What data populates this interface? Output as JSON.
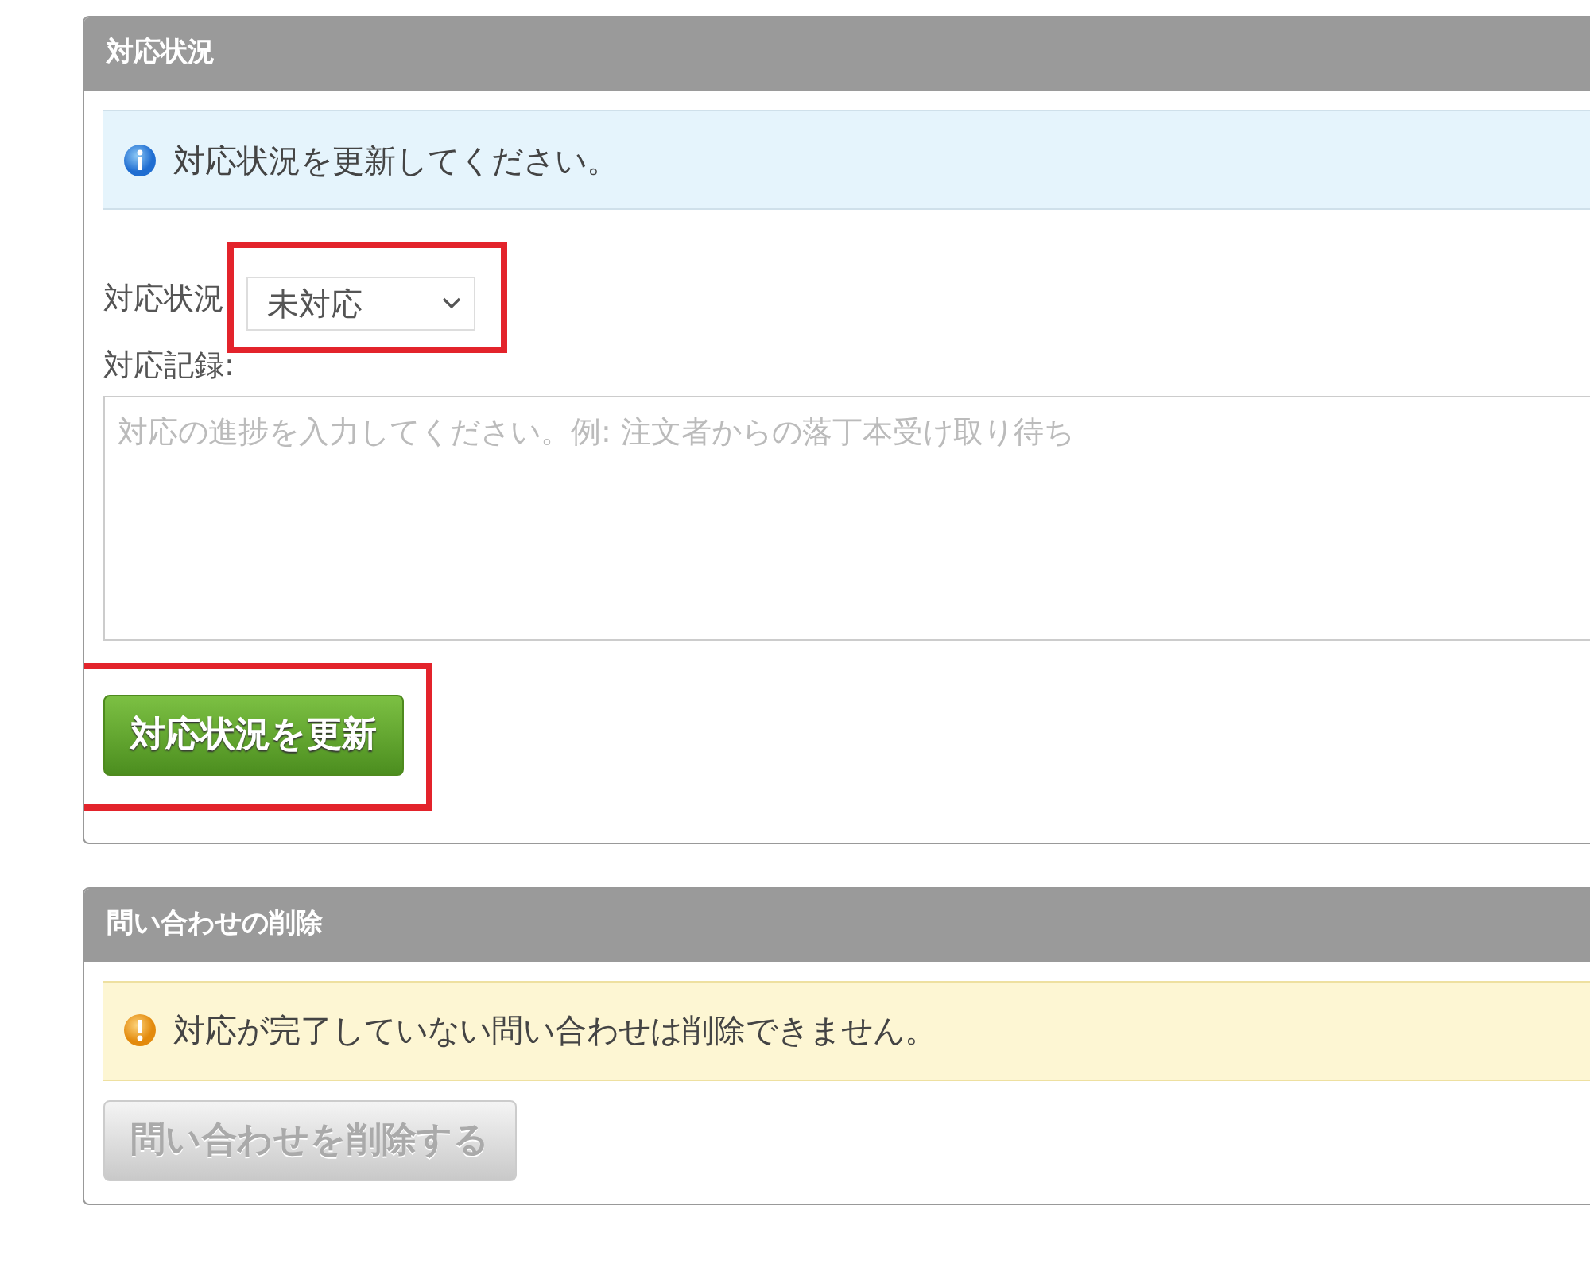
{
  "panels": [
    {
      "title": "対応状況",
      "alert": {
        "kind": "info",
        "text": "対応状況を更新してください。"
      },
      "status_field": {
        "label": "対応状況",
        "value": "未対応",
        "highlighted": true
      },
      "record_field": {
        "label": "対応記録:",
        "placeholder": "対応の進捗を入力してください。例: 注文者からの落丁本受け取り待ち"
      },
      "button": {
        "label": "対応状況を更新",
        "disabled": false,
        "highlighted": true
      }
    },
    {
      "title": "問い合わせの削除",
      "alert": {
        "kind": "warning",
        "text": "対応が完了していない問い合わせは削除できません。"
      },
      "button": {
        "label": "問い合わせを削除する",
        "disabled": true
      }
    }
  ]
}
